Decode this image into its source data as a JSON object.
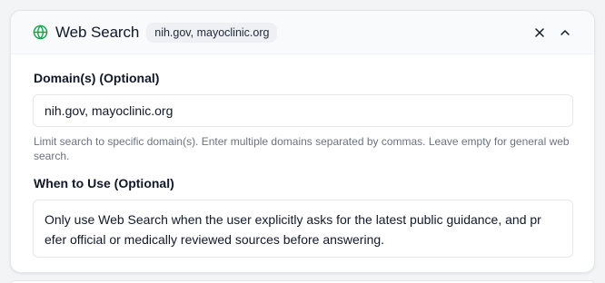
{
  "header": {
    "title": "Web Search",
    "badge": "nih.gov, mayoclinic.org",
    "icon": "globe-icon",
    "accent_color": "#16a34a"
  },
  "domains": {
    "label": "Domain(s) (Optional)",
    "value": "nih.gov, mayoclinic.org",
    "help": "Limit search to specific domain(s). Enter multiple domains separated by commas. Leave empty for general web search."
  },
  "when_to_use": {
    "label": "When to Use (Optional)",
    "line1": "Only use Web Search when the user explicitly asks for the latest public guidance, and pr",
    "line2": "efer official or medically reviewed sources before answering."
  }
}
